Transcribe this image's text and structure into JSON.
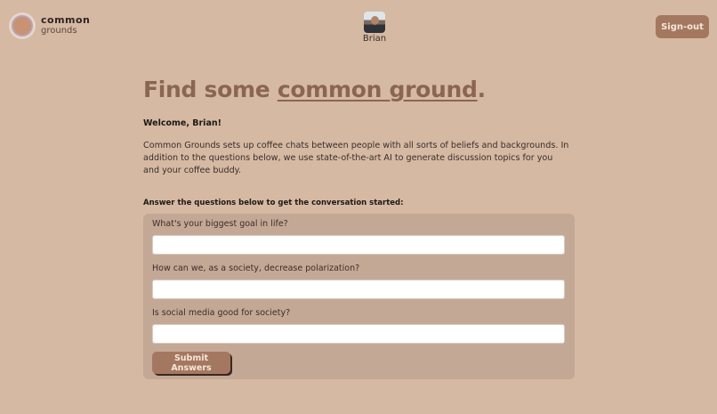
{
  "header": {
    "logo_line1": "common",
    "logo_line2": "grounds",
    "user_name": "Brian",
    "signout_label": "Sign-out"
  },
  "main": {
    "title_prefix": "Find some ",
    "title_link": "common ground",
    "title_suffix": ".",
    "welcome": "Welcome, Brian!",
    "intro": "Common Grounds sets up coffee chats between people with all sorts of beliefs and backgrounds. In addition to the questions below, we use state-of-the-art AI to generate discussion topics for you and your coffee buddy.",
    "prompt": "Answer the questions below to get the conversation started:"
  },
  "form": {
    "questions": [
      {
        "label": "What's your biggest goal in life?",
        "value": ""
      },
      {
        "label": "How can we, as a society, decrease polarization?",
        "value": ""
      },
      {
        "label": "Is social media good for society?",
        "value": ""
      }
    ],
    "submit_label": "Submit Answers"
  },
  "colors": {
    "background": "#d5b9a3",
    "accent": "#8a6650",
    "button": "#a47860",
    "card": "#c4a896"
  }
}
